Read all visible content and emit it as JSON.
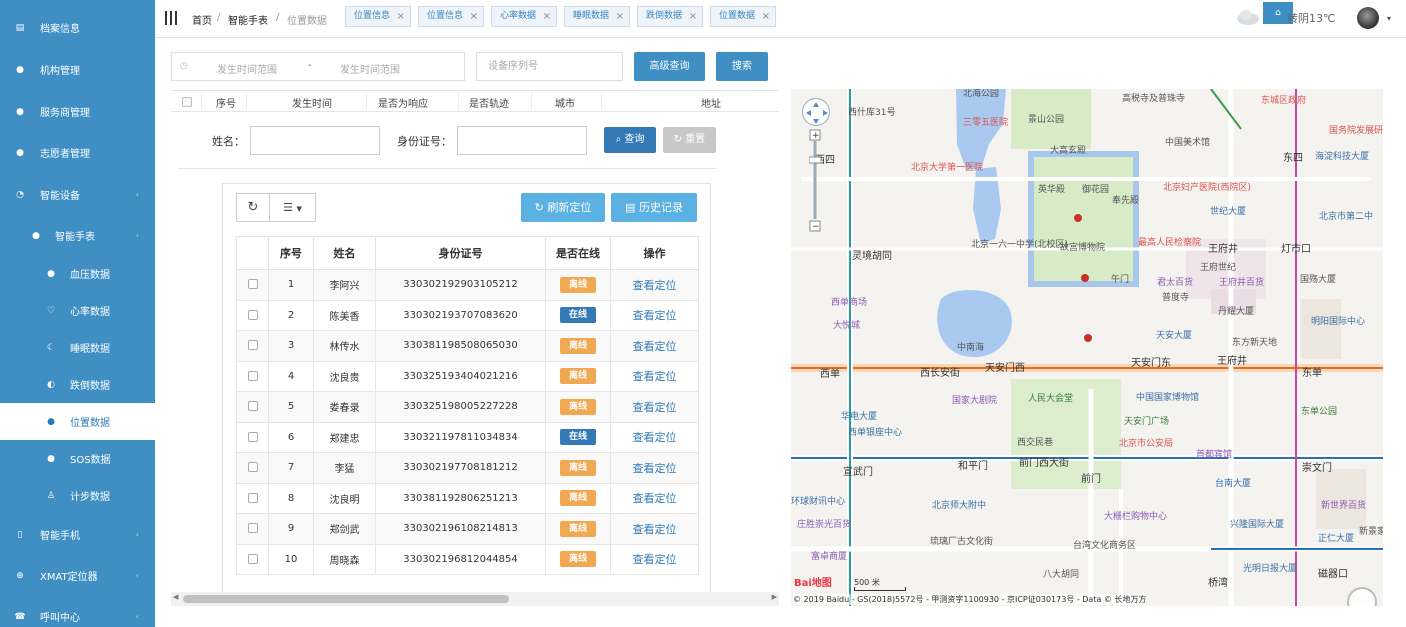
{
  "sidebar": {
    "items": [
      {
        "label": "档案信息",
        "icon": "archive-icon",
        "glyph": "▤"
      },
      {
        "label": "机构管理",
        "icon": "group-icon",
        "glyph": "●"
      },
      {
        "label": "服务商管理",
        "icon": "user-icon",
        "glyph": "●"
      },
      {
        "label": "志愿者管理",
        "icon": "volunteer-icon",
        "glyph": "●"
      },
      {
        "label": "智能设备",
        "icon": "device-icon",
        "glyph": "◔"
      },
      {
        "label": "智能手表",
        "icon": "watch-icon",
        "glyph": "●"
      },
      {
        "label": "血压数据",
        "icon": "drop-icon",
        "glyph": "●"
      },
      {
        "label": "心率数据",
        "icon": "heart-icon",
        "glyph": "♡"
      },
      {
        "label": "睡眠数据",
        "icon": "moon-icon",
        "glyph": "☾"
      },
      {
        "label": "跌倒数据",
        "icon": "fall-icon",
        "glyph": "◐"
      },
      {
        "label": "位置数据",
        "icon": "location-icon",
        "glyph": "●"
      },
      {
        "label": "SOS数据",
        "icon": "sos-icon",
        "glyph": "●"
      },
      {
        "label": "计步数据",
        "icon": "step-icon",
        "glyph": "♙"
      },
      {
        "label": "智能手机",
        "icon": "phone-icon",
        "glyph": "▯"
      },
      {
        "label": "XMAT定位器",
        "icon": "target-icon",
        "glyph": "⊕"
      },
      {
        "label": "呼叫中心",
        "icon": "call-icon",
        "glyph": "☎"
      }
    ]
  },
  "topbar": {
    "breadcrumb": [
      "首页",
      "智能手表",
      "位置数据"
    ],
    "tabs": [
      "位置信息",
      "位置信息",
      "心率数据",
      "睡眠数据",
      "跌倒数据",
      "位置数据"
    ],
    "tab_close": "×",
    "home_glyph": "⌂",
    "weather": "转阴13℃",
    "caret": "▾"
  },
  "filter": {
    "date_start_placeholder": "发生时间范围",
    "date_sep": "-",
    "date_end_placeholder": "发生时间范围",
    "device_placeholder": "设备序列号",
    "advanced_label": "高级查询",
    "search_label": "搜索"
  },
  "bg_table": {
    "columns": [
      "序号",
      "发生时间",
      "是否为响应",
      "是否轨迹",
      "城市",
      "地址"
    ]
  },
  "popup": {
    "name_label": "姓名：",
    "id_label": "身份证号：",
    "query_label": "查询",
    "reset_label": "重置",
    "refresh_label": "刷新定位",
    "history_label": "历史记录",
    "columns": [
      "序号",
      "姓名",
      "身份证号",
      "是否在线",
      "操作"
    ],
    "rows": [
      {
        "no": "1",
        "name": "李阿兴",
        "id": "330302192903105212",
        "status": "离线",
        "online": false,
        "action": "查看定位"
      },
      {
        "no": "2",
        "name": "陈美香",
        "id": "330302193707083620",
        "status": "在线",
        "online": true,
        "action": "查看定位"
      },
      {
        "no": "3",
        "name": "林传水",
        "id": "330381198508065030",
        "status": "离线",
        "online": false,
        "action": "查看定位"
      },
      {
        "no": "4",
        "name": "沈良贵",
        "id": "330325193404021216",
        "status": "离线",
        "online": false,
        "action": "查看定位"
      },
      {
        "no": "5",
        "name": "娄春录",
        "id": "330325198005227228",
        "status": "离线",
        "online": false,
        "action": "查看定位"
      },
      {
        "no": "6",
        "name": "郑建忠",
        "id": "330321197811034834",
        "status": "在线",
        "online": true,
        "action": "查看定位"
      },
      {
        "no": "7",
        "name": "李猛",
        "id": "330302197708181212",
        "status": "离线",
        "online": false,
        "action": "查看定位"
      },
      {
        "no": "8",
        "name": "沈良明",
        "id": "330381192806251213",
        "status": "离线",
        "online": false,
        "action": "查看定位"
      },
      {
        "no": "9",
        "name": "郑剑武",
        "id": "330302196108214813",
        "status": "离线",
        "online": false,
        "action": "查看定位"
      },
      {
        "no": "10",
        "name": "周晓森",
        "id": "330302196812044854",
        "status": "离线",
        "online": false,
        "action": "查看定位"
      }
    ]
  },
  "map": {
    "scale": "500 米",
    "logo": "Bai地图",
    "copyright": "© 2019 Baidu - GS(2018)5572号 - 甲测资字1100930 - 京ICP证030173号 - Data © 长地万方",
    "labels": [
      {
        "t": "北海公园",
        "c": ""
      },
      {
        "t": "景山公园",
        "c": ""
      },
      {
        "t": "高税寺及普珠寺",
        "c": ""
      },
      {
        "t": "东城区政府",
        "c": "red"
      },
      {
        "t": "西什库31号",
        "c": ""
      },
      {
        "t": "三零五医院",
        "c": "red"
      },
      {
        "t": "大高玄殿",
        "c": ""
      },
      {
        "t": "中国美术馆",
        "c": ""
      },
      {
        "t": "国务院发展研究中心",
        "c": "red"
      },
      {
        "t": "北京大学第一医院",
        "c": "red"
      },
      {
        "t": "西四",
        "c": "road"
      },
      {
        "t": "英华殿",
        "c": ""
      },
      {
        "t": "御花园",
        "c": ""
      },
      {
        "t": "奉先殿",
        "c": ""
      },
      {
        "t": "北京妇产医院(西院区)",
        "c": "red"
      },
      {
        "t": "东四",
        "c": "road"
      },
      {
        "t": "海淀科技大厦",
        "c": "blue"
      },
      {
        "t": "世纪大厦",
        "c": "blue"
      },
      {
        "t": "北京市第二中",
        "c": "blue"
      },
      {
        "t": "灵境胡同",
        "c": "road"
      },
      {
        "t": "北京一六一中学(北校区)",
        "c": ""
      },
      {
        "t": "故宫博物院",
        "c": ""
      },
      {
        "t": "最高人民检察院",
        "c": "red"
      },
      {
        "t": "王府井",
        "c": "road"
      },
      {
        "t": "灯市口",
        "c": "road"
      },
      {
        "t": "王府世纪",
        "c": ""
      },
      {
        "t": "君太百货",
        "c": "purple"
      },
      {
        "t": "西单商场",
        "c": "purple"
      },
      {
        "t": "午门",
        "c": ""
      },
      {
        "t": "王府井百货",
        "c": "purple"
      },
      {
        "t": "国殇大厦",
        "c": ""
      },
      {
        "t": "大悦城",
        "c": "purple"
      },
      {
        "t": "普度寺",
        "c": ""
      },
      {
        "t": "丹耀大厦",
        "c": ""
      },
      {
        "t": "明阳国际中心",
        "c": "blue"
      },
      {
        "t": "东方新天地",
        "c": ""
      },
      {
        "t": "天安大厦",
        "c": "blue"
      },
      {
        "t": "中南海",
        "c": ""
      },
      {
        "t": "西单",
        "c": "road"
      },
      {
        "t": "西长安街",
        "c": "road"
      },
      {
        "t": "天安门西",
        "c": "road"
      },
      {
        "t": "天安门东",
        "c": "road"
      },
      {
        "t": "王府井",
        "c": "road"
      },
      {
        "t": "东单",
        "c": "road"
      },
      {
        "t": "国家大剧院",
        "c": "purple"
      },
      {
        "t": "人民大会堂",
        "c": "green"
      },
      {
        "t": "中国国家博物馆",
        "c": "blue"
      },
      {
        "t": "华电大厦",
        "c": "blue"
      },
      {
        "t": "天安门广场",
        "c": "green"
      },
      {
        "t": "东单公园",
        "c": "green"
      },
      {
        "t": "西单银座中心",
        "c": "blue"
      },
      {
        "t": "西交民巷",
        "c": ""
      },
      {
        "t": "北京市公安局",
        "c": "red"
      },
      {
        "t": "首都宾馆",
        "c": "purple"
      },
      {
        "t": "宣武门",
        "c": "road"
      },
      {
        "t": "和平门",
        "c": "road"
      },
      {
        "t": "前门西大街",
        "c": "road"
      },
      {
        "t": "前门",
        "c": "road"
      },
      {
        "t": "崇文门",
        "c": "road"
      },
      {
        "t": "台南大厦",
        "c": "blue"
      },
      {
        "t": "环球财讯中心",
        "c": "blue"
      },
      {
        "t": "北京师大附中",
        "c": "blue"
      },
      {
        "t": "大栅栏购物中心",
        "c": "purple"
      },
      {
        "t": "兴隆国际大厦",
        "c": "blue"
      },
      {
        "t": "新世界百货",
        "c": "purple"
      },
      {
        "t": "庄胜崇光百货",
        "c": "purple"
      },
      {
        "t": "琉璃厂古文化街",
        "c": ""
      },
      {
        "t": "台湾文化商务区",
        "c": ""
      },
      {
        "t": "正仁大厦",
        "c": "blue"
      },
      {
        "t": "富卓商厦",
        "c": "purple"
      },
      {
        "t": "八大胡同",
        "c": ""
      },
      {
        "t": "桥湾",
        "c": "road"
      },
      {
        "t": "光明日报大厦",
        "c": "blue"
      },
      {
        "t": "新景家园",
        "c": ""
      },
      {
        "t": "磁器口",
        "c": "road"
      }
    ]
  },
  "colors": {
    "sidebar": "#3f8fc4",
    "primary": "#337ab7",
    "offline": "#f0a952",
    "online": "#337ab7"
  }
}
